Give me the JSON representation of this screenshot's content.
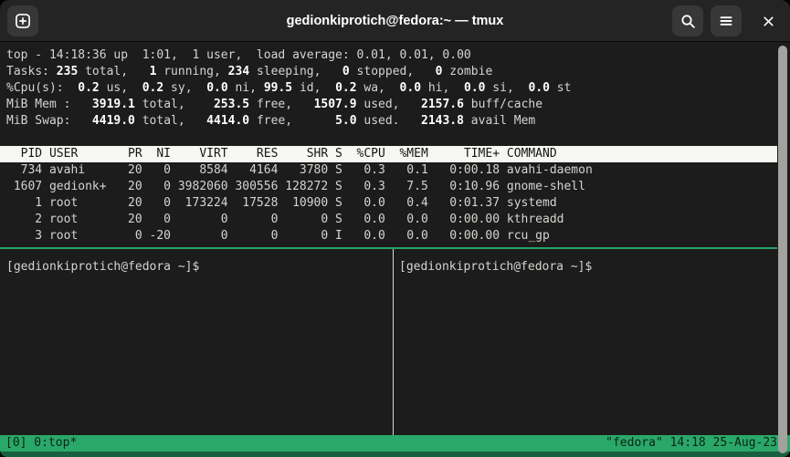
{
  "window": {
    "title": "gedionkiprotich@fedora:~ — tmux"
  },
  "titlebar": {
    "icons": [
      "new-tab-icon",
      "search-icon",
      "hamburger-menu-icon",
      "close-icon"
    ]
  },
  "terminal": {
    "top_output": {
      "summary": [
        [
          "top - 14:18:36 up  1:01,  1 user,  load average: 0.01, 0.01, 0.00"
        ],
        [
          "Tasks: ",
          {
            "b": "235"
          },
          " total,   ",
          {
            "b": "1"
          },
          " running, ",
          {
            "b": "234"
          },
          " sleeping,   ",
          {
            "b": "0"
          },
          " stopped,   ",
          {
            "b": "0"
          },
          " zombie"
        ],
        [
          "%Cpu(s):  ",
          {
            "b": "0.2"
          },
          " us,  ",
          {
            "b": "0.2"
          },
          " sy,  ",
          {
            "b": "0.0"
          },
          " ni, ",
          {
            "b": "99.5"
          },
          " id,  ",
          {
            "b": "0.2"
          },
          " wa,  ",
          {
            "b": "0.0"
          },
          " hi,  ",
          {
            "b": "0.0"
          },
          " si,  ",
          {
            "b": "0.0"
          },
          " st"
        ],
        [
          "MiB Mem :   ",
          {
            "b": "3919.1"
          },
          " total,    ",
          {
            "b": "253.5"
          },
          " free,   ",
          {
            "b": "1507.9"
          },
          " used,   ",
          {
            "b": "2157.6"
          },
          " buff/cache"
        ],
        [
          "MiB Swap:   ",
          {
            "b": "4419.0"
          },
          " total,   ",
          {
            "b": "4414.0"
          },
          " free,      ",
          {
            "b": "5.0"
          },
          " used.   ",
          {
            "b": "2143.8"
          },
          " avail Mem"
        ]
      ],
      "columns": [
        {
          "label": "PID",
          "w": 5,
          "align": "right"
        },
        {
          "label": "USER",
          "w": 9,
          "align": "left"
        },
        {
          "label": "PR",
          "w": 3,
          "align": "right"
        },
        {
          "label": "NI",
          "w": 3,
          "align": "right"
        },
        {
          "label": "VIRT",
          "w": 7,
          "align": "right"
        },
        {
          "label": "RES",
          "w": 6,
          "align": "right"
        },
        {
          "label": "SHR",
          "w": 6,
          "align": "right"
        },
        {
          "label": "S",
          "w": 1,
          "align": "left"
        },
        {
          "label": "%CPU",
          "w": 5,
          "align": "right"
        },
        {
          "label": "%MEM",
          "w": 5,
          "align": "right"
        },
        {
          "label": "TIME+",
          "w": 9,
          "align": "right"
        },
        {
          "label": "COMMAND",
          "w": 0,
          "align": "left"
        }
      ],
      "processes": [
        [
          "734",
          "avahi",
          "20",
          "0",
          "8584",
          "4164",
          "3780",
          "S",
          "0.3",
          "0.1",
          "0:00.18",
          "avahi-daemon"
        ],
        [
          "1607",
          "gedionk+",
          "20",
          "0",
          "3982060",
          "300556",
          "128272",
          "S",
          "0.3",
          "7.5",
          "0:10.96",
          "gnome-shell"
        ],
        [
          "1",
          "root",
          "20",
          "0",
          "173224",
          "17528",
          "10900",
          "S",
          "0.0",
          "0.4",
          "0:01.37",
          "systemd"
        ],
        [
          "2",
          "root",
          "20",
          "0",
          "0",
          "0",
          "0",
          "S",
          "0.0",
          "0.0",
          "0:00.00",
          "kthreadd"
        ],
        [
          "3",
          "root",
          "0",
          "-20",
          "0",
          "0",
          "0",
          "I",
          "0.0",
          "0.0",
          "0:00.00",
          "rcu_gp"
        ]
      ]
    },
    "left_pane": {
      "prompt": "[gedionkiprotich@fedora ~]$"
    },
    "right_pane": {
      "prompt": "[gedionkiprotich@fedora ~]$"
    },
    "status": {
      "left": "[0] 0:top*",
      "right": "\"fedora\" 14:18 25-Aug-23"
    }
  },
  "colors": {
    "titlebar_bg": "#242424",
    "terminal_bg": "#1c1c1c",
    "foreground": "#d4d4d0",
    "bold_foreground": "#ffffff",
    "pane_border_green": "#26a269",
    "pane_border_inactive": "#d8d8d3",
    "status_bar_green": "#2aa869",
    "status_bar_edge_green": "#186040",
    "table_header_bg": "#f6f6f3",
    "table_header_fg": "#151515",
    "scrollbar_thumb": "#a4a29f"
  }
}
